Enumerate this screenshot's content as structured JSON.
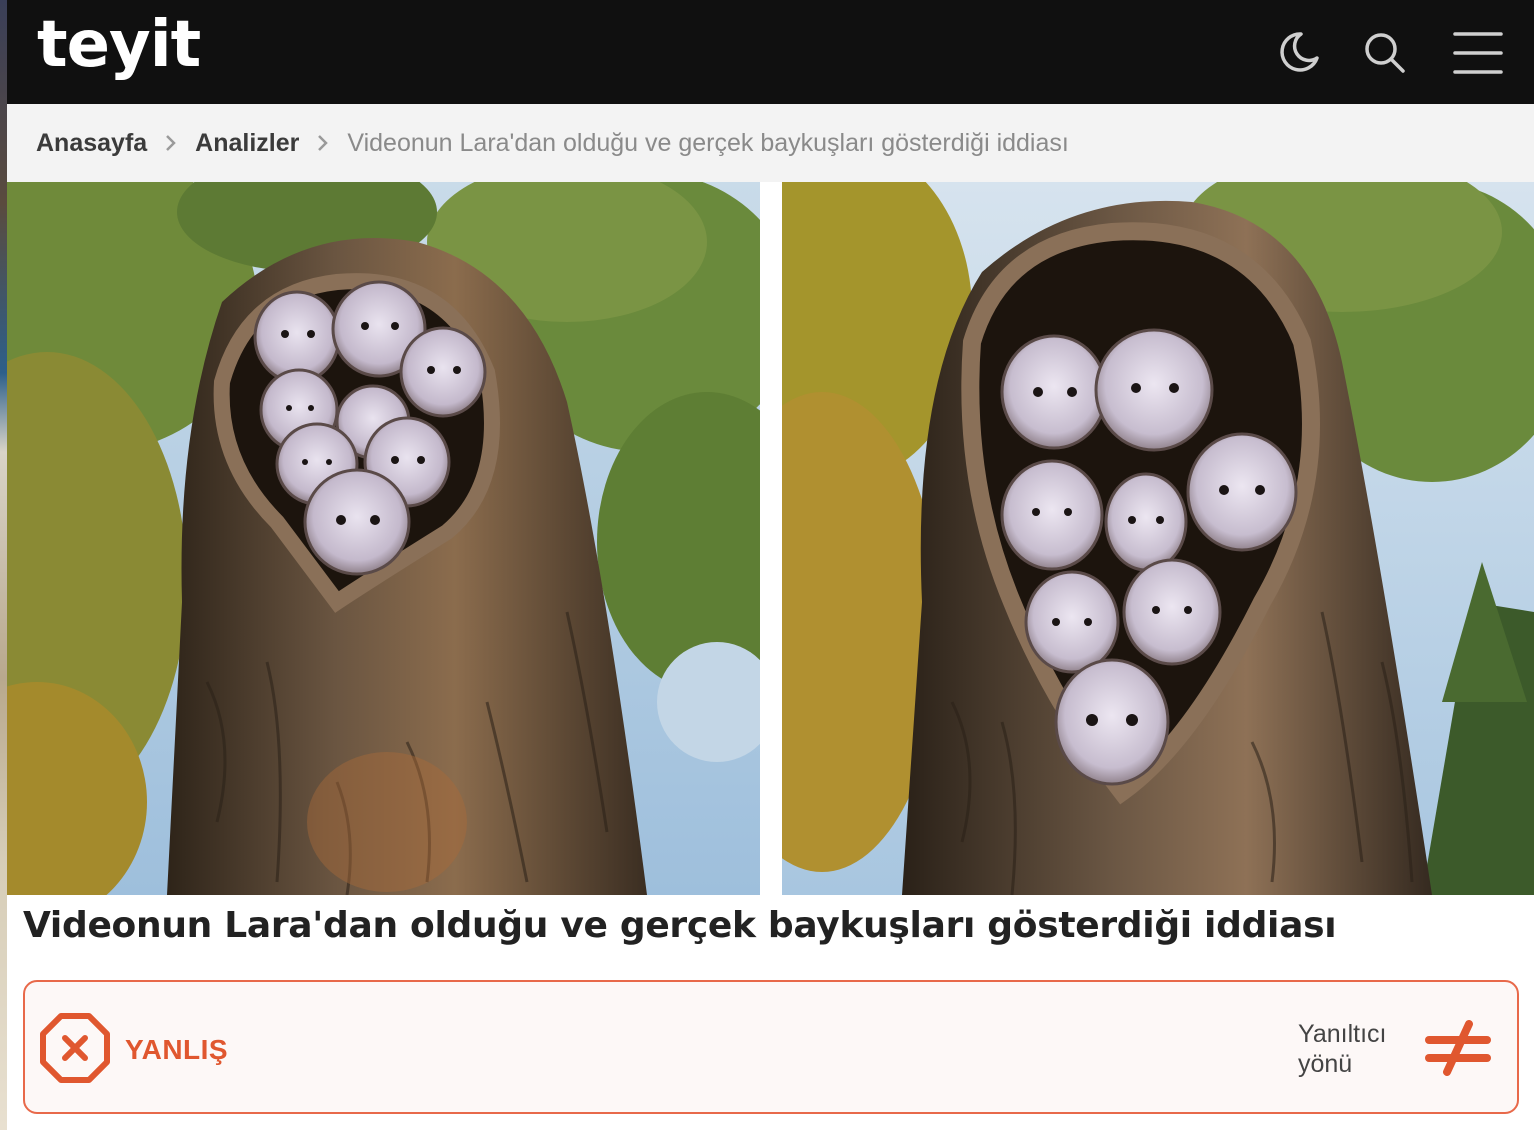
{
  "header": {
    "logo": "teyit",
    "icons": [
      "moon-icon",
      "search-icon",
      "menu-icon"
    ],
    "background_color": "#101010"
  },
  "breadcrumb": {
    "items": [
      "Anasayfa",
      "Analizler"
    ],
    "current": "Videonun Lara'dan olduğu ve gerçek baykuşları gösterdiği iddiası"
  },
  "article": {
    "title": "Videonun Lara'dan olduğu ve gerçek baykuşları gösterdiği iddiası",
    "image_description_icon": "owls-in-tree-hollow-image"
  },
  "verdict": {
    "label": "YANLIŞ",
    "icon": "x-octagon-icon",
    "color": "#e0572f",
    "misleading_label": "Yanıltıcı yönü",
    "misleading_icon": "not-equal-icon"
  }
}
